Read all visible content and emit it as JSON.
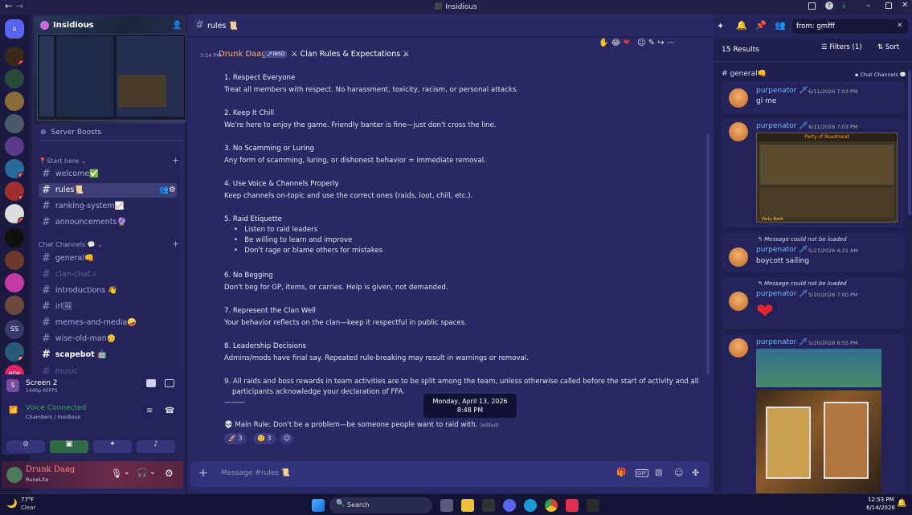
{
  "window": {
    "title": "Insidious"
  },
  "server": {
    "name": "Insidious",
    "boosts_label": "Server Boosts"
  },
  "categories": {
    "start": "Start here",
    "chat": "Chat Channels"
  },
  "start_channels": [
    {
      "name": "welcome",
      "emoji": "✅"
    },
    {
      "name": "rules",
      "emoji": "📜"
    },
    {
      "name": "ranking-system",
      "emoji": "📈"
    },
    {
      "name": "announcements",
      "emoji": "🔮"
    }
  ],
  "chat_channels": [
    {
      "name": "general",
      "emoji": "👊"
    },
    {
      "name": "clan-chat",
      "emoji": "⚔"
    },
    {
      "name": "introductions",
      "emoji": "👋"
    },
    {
      "name": "irl",
      "emoji": "🖼"
    },
    {
      "name": "memes-and-media",
      "emoji": "🤪"
    },
    {
      "name": "wise-old-man",
      "emoji": "👴"
    },
    {
      "name": "scapebot",
      "emoji": "🤖"
    },
    {
      "name": "music",
      "emoji": "🎵"
    }
  ],
  "guild_badges": [
    "1",
    "17",
    "18",
    "3",
    "81"
  ],
  "guild_ss": "SS",
  "guild_new": "NEW",
  "voice": {
    "screen_title": "Screen 2",
    "screen_sub": "1440p 60FPS",
    "status": "Voice Connected",
    "channel": "Chambers / Insidious"
  },
  "user": {
    "name": "Drunk Daag",
    "status": "RuneLite"
  },
  "header": {
    "channel": "rules",
    "channel_emoji": "📜"
  },
  "message": {
    "time": "3:14 PM",
    "author": "Drunk Daag",
    "tag": "INSD",
    "title": "⚔ Clan Rules & Expectations ⚔",
    "rules": [
      {
        "h": "1. Respect Everyone",
        "b": "Treat all members with respect. No harassment, toxicity, racism, or personal attacks."
      },
      {
        "h": "2. Keep It Chill",
        "b": "We're here to enjoy the game. Friendly banter is fine—just don't cross the line."
      },
      {
        "h": "3. No Scamming or Luring",
        "b": "Any form of scamming, luring, or dishonest behavior = immediate removal."
      },
      {
        "h": "4. Use Voice & Channels Properly",
        "b": "Keep channels on-topic and use the correct ones (raids, loot, chill, etc.)."
      }
    ],
    "rule5_title": "5. Raid Etiquette",
    "rule5_bullets": [
      "Listen to raid leaders",
      "Be willing to learn and improve",
      "Don't rage or blame others for mistakes"
    ],
    "rules_b": [
      {
        "h": "6. No Begging",
        "b": "Don't beg for GP, items, or carries. Help is given, not demanded."
      },
      {
        "h": "7. Represent the Clan Well",
        "b": "Your behavior reflects on the clan—keep it respectful in public spaces."
      },
      {
        "h": "8. Leadership Decisions",
        "b": "Admins/mods have final say. Repeated rule-breaking may result in warnings or removal."
      }
    ],
    "rule9_line1": "9. All raids and boss rewards in team activities are to be split among the team, unless otherwise called before the start of activity and all",
    "rule9_line2": "participants acknowledge your declaration of FFA.",
    "divider": "———",
    "main_rule": "💀 Main Rule: Don't be a problem—be someone people want to raid with.",
    "edited": "(edited)",
    "tooltip": "Monday, April 13, 2026 8:48 PM",
    "reactions": [
      {
        "emoji": "🚀",
        "count": "3"
      },
      {
        "emoji": "🤨",
        "count": "3"
      }
    ]
  },
  "composer": {
    "placeholder": "Message #rules 📜"
  },
  "search": {
    "query": "from: gmfff",
    "count": "15 Results",
    "filters": "Filters (1)",
    "sort": "Sort",
    "channel": "general👊",
    "channel_link": "Chat Channels",
    "not_loaded": "Message could not be loaded",
    "results": [
      {
        "user": "purpenator",
        "time": "6/11/2026 7:03 PM",
        "text": "gl me"
      },
      {
        "user": "purpenator",
        "time": "6/11/2026 7:03 PM",
        "text": "",
        "img_title": "Party of Roadmeat",
        "img_footer": "Party Bank"
      },
      {
        "user": "purpenator",
        "time": "5/27/2026 4:21 AM",
        "text": "boycott sailing"
      },
      {
        "user": "purpenator",
        "time": "5/20/2026 7:00 PM",
        "text": "❤"
      },
      {
        "user": "purpenator",
        "time": "5/20/2026 6:55 PM",
        "text": ""
      }
    ]
  },
  "taskbar": {
    "weather_temp": "77°F",
    "weather_text": "Clear",
    "search": "Search",
    "time": "12:53 PM",
    "date": "6/14/2026"
  }
}
